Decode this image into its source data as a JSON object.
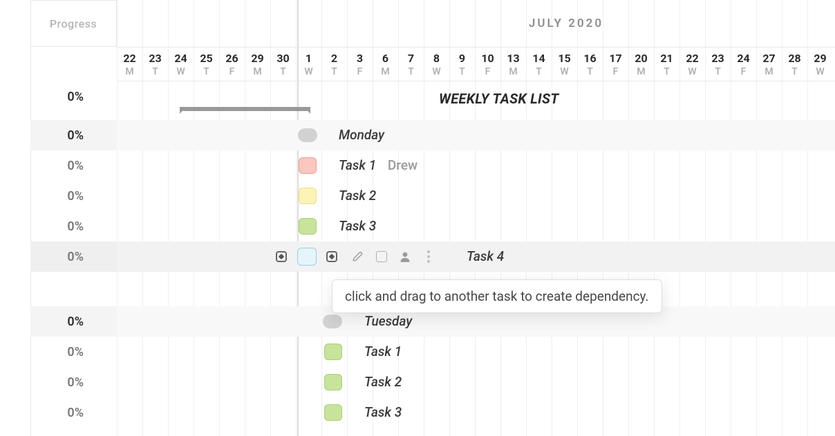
{
  "header": {
    "progress_label": "Progress",
    "month_label": "JULY 2020"
  },
  "days": [
    {
      "n": "22",
      "d": "M"
    },
    {
      "n": "23",
      "d": "T"
    },
    {
      "n": "24",
      "d": "W"
    },
    {
      "n": "25",
      "d": "T"
    },
    {
      "n": "26",
      "d": "F"
    },
    {
      "n": "29",
      "d": "M"
    },
    {
      "n": "30",
      "d": "T"
    },
    {
      "n": "1",
      "d": "W"
    },
    {
      "n": "2",
      "d": "T"
    },
    {
      "n": "3",
      "d": "F"
    },
    {
      "n": "6",
      "d": "M"
    },
    {
      "n": "7",
      "d": "T"
    },
    {
      "n": "8",
      "d": "W"
    },
    {
      "n": "9",
      "d": "T"
    },
    {
      "n": "10",
      "d": "F"
    },
    {
      "n": "13",
      "d": "M"
    },
    {
      "n": "14",
      "d": "T"
    },
    {
      "n": "15",
      "d": "W"
    },
    {
      "n": "16",
      "d": "T"
    },
    {
      "n": "17",
      "d": "F"
    },
    {
      "n": "20",
      "d": "M"
    },
    {
      "n": "21",
      "d": "T"
    },
    {
      "n": "22",
      "d": "W"
    },
    {
      "n": "23",
      "d": "T"
    },
    {
      "n": "24",
      "d": "F"
    },
    {
      "n": "27",
      "d": "M"
    },
    {
      "n": "28",
      "d": "T"
    },
    {
      "n": "29",
      "d": "W"
    }
  ],
  "title": {
    "label": "WEEKLY TASK LIST"
  },
  "progress": {
    "row_title": "0%",
    "rows": [
      "0%",
      "0%",
      "0%",
      "0%",
      "0%",
      "0%",
      "0%",
      "0%",
      "0%"
    ]
  },
  "groups": [
    {
      "header": {
        "label": "Monday"
      },
      "tasks": [
        {
          "label": "Task 1",
          "assignee": "Drew",
          "color": "red"
        },
        {
          "label": "Task 2",
          "color": "yellow"
        },
        {
          "label": "Task 3",
          "color": "green"
        },
        {
          "label": "Task 4",
          "color": "blue",
          "selected": true
        }
      ]
    },
    {
      "header": {
        "label": "Tuesday"
      },
      "tasks": [
        {
          "label": "Task 1",
          "color": "green"
        },
        {
          "label": "Task 2",
          "color": "green"
        },
        {
          "label": "Task 3",
          "color": "green"
        }
      ]
    }
  ],
  "tooltip": {
    "text": "click and drag to another task to create dependency."
  },
  "icons": {
    "dependency_handle": "dependency-handle-icon",
    "pencil": "pencil-icon",
    "color_swatch": "color-swatch-icon",
    "person": "person-icon",
    "more": "more-vertical-icon"
  }
}
